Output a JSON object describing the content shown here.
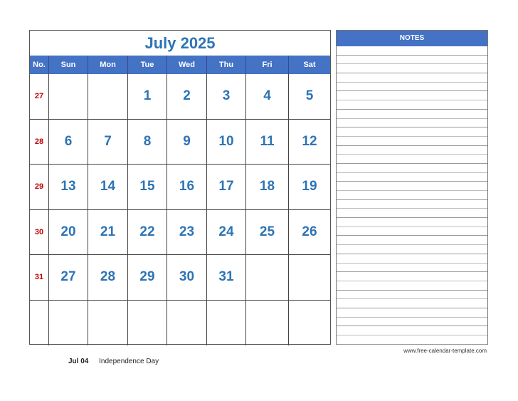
{
  "calendar": {
    "title": "July 2025",
    "headers": [
      "No.",
      "Sun",
      "Mon",
      "Tue",
      "Wed",
      "Thu",
      "Fri",
      "Sat"
    ],
    "weeks": [
      {
        "no": "27",
        "days": [
          "",
          "",
          "1",
          "2",
          "3",
          "4",
          "5"
        ]
      },
      {
        "no": "28",
        "days": [
          "6",
          "7",
          "8",
          "9",
          "10",
          "11",
          "12"
        ]
      },
      {
        "no": "29",
        "days": [
          "13",
          "14",
          "15",
          "16",
          "17",
          "18",
          "19"
        ]
      },
      {
        "no": "30",
        "days": [
          "20",
          "21",
          "22",
          "23",
          "24",
          "25",
          "26"
        ]
      },
      {
        "no": "31",
        "days": [
          "27",
          "28",
          "29",
          "30",
          "31",
          "",
          ""
        ]
      },
      {
        "no": "",
        "days": [
          "",
          "",
          "",
          "",
          "",
          "",
          ""
        ]
      }
    ]
  },
  "notes": {
    "title": "NOTES",
    "line_count": 33
  },
  "footer": {
    "website": "www.free-calendar-template.com"
  },
  "holidays": [
    {
      "date": "Jul 04",
      "name": "Independence Day"
    }
  ],
  "colors": {
    "accent": "#4472c4",
    "day_text": "#2e74b5",
    "week_no": "#c00000"
  }
}
